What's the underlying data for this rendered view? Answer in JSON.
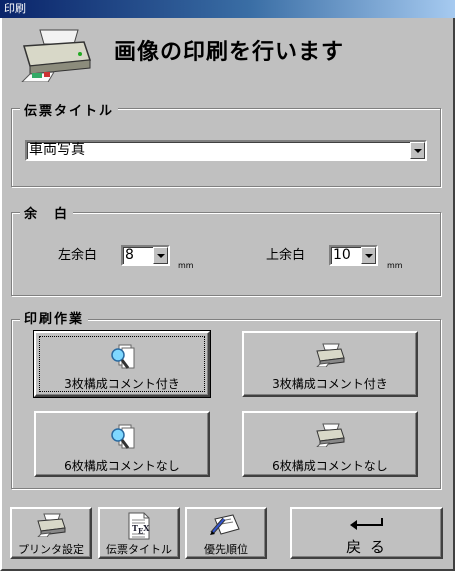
{
  "window": {
    "title": "印刷"
  },
  "header": {
    "title": "画像の印刷を行います",
    "icon": "printer-icon"
  },
  "slip_title_group": {
    "label": "伝票タイトル",
    "combo_value": "車両写真"
  },
  "margin_group": {
    "label": "余　白",
    "left_label": "左余白",
    "left_value": "8",
    "left_unit": "mm",
    "top_label": "上余白",
    "top_value": "10",
    "top_unit": "mm"
  },
  "print_group": {
    "label": "印刷作業",
    "buttons": [
      {
        "label": "3枚構成コメント付き",
        "icon": "preview-icon"
      },
      {
        "label": "3枚構成コメント付き",
        "icon": "printer-icon"
      },
      {
        "label": "6枚構成コメントなし",
        "icon": "preview-icon"
      },
      {
        "label": "6枚構成コメントなし",
        "icon": "printer-icon"
      }
    ]
  },
  "bottom_bar": {
    "printer_settings": "プリンタ設定",
    "slip_title": "伝票タイトル",
    "priority": "優先順位",
    "back": "戻 る"
  }
}
